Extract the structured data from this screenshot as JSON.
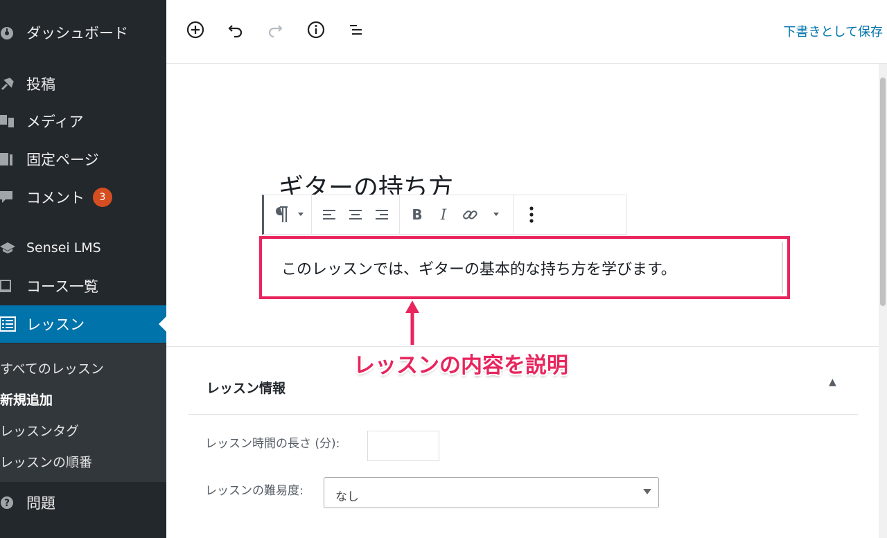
{
  "sidebar": {
    "items": [
      {
        "label": "ダッシュボード",
        "icon": "dashboard-icon"
      },
      {
        "label": "投稿",
        "icon": "pin-icon"
      },
      {
        "label": "メディア",
        "icon": "media-icon"
      },
      {
        "label": "固定ページ",
        "icon": "page-icon"
      },
      {
        "label": "コメント",
        "icon": "comment-icon",
        "badge": "3"
      },
      {
        "label": "Sensei LMS",
        "icon": "sensei-icon"
      },
      {
        "label": "コース一覧",
        "icon": "book-icon"
      },
      {
        "label": "レッスン",
        "icon": "list-icon",
        "active": true
      },
      {
        "label": "問題",
        "icon": "question-icon"
      }
    ],
    "submenu": [
      {
        "label": "すべてのレッスン"
      },
      {
        "label": "新規追加",
        "current": true
      },
      {
        "label": "レッスンタグ"
      },
      {
        "label": "レッスンの順番"
      }
    ]
  },
  "topbar": {
    "save_draft": "下書きとして保存",
    "tools": [
      "add-block-icon",
      "undo-icon",
      "redo-icon",
      "info-icon",
      "outline-icon"
    ]
  },
  "editor": {
    "post_title": "ギターの持ち方",
    "paragraph": "このレッスンでは、ギターの基本的な持ち方を学びます。",
    "annotation": "レッスンの内容を説明"
  },
  "metabox": {
    "title": "レッスン情報",
    "length_label": "レッスン時間の長さ (分):",
    "length_value": "",
    "difficulty_label": "レッスンの難易度:",
    "difficulty_value": "なし"
  },
  "colors": {
    "sidebar_bg": "#23282d",
    "submenu_bg": "#32373c",
    "active": "#0073aa",
    "badge": "#d54e21",
    "highlight": "#e8255d"
  }
}
